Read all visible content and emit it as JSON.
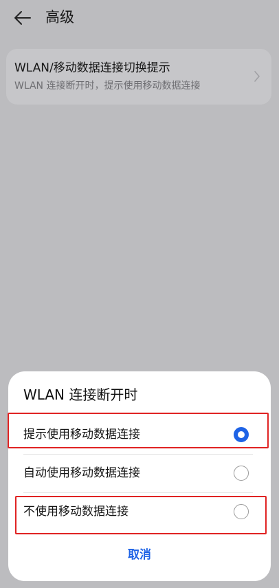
{
  "header": {
    "back_icon": "arrow-left-icon",
    "title": "高级"
  },
  "setting": {
    "title": "WLAN/移动数据连接切换提示",
    "subtitle": "WLAN 连接断开时，提示使用移动数据连接",
    "chevron_icon": "chevron-right-icon"
  },
  "dialog": {
    "title": "WLAN 连接断开时",
    "options": [
      {
        "label": "提示使用移动数据连接",
        "selected": true
      },
      {
        "label": "自动使用移动数据连接",
        "selected": false
      },
      {
        "label": "不使用移动数据连接",
        "selected": false
      }
    ],
    "cancel_label": "取消"
  },
  "colors": {
    "accent": "#1e63e6",
    "highlight_box": "#e02323",
    "scrim_background": "#bcbcbf"
  }
}
